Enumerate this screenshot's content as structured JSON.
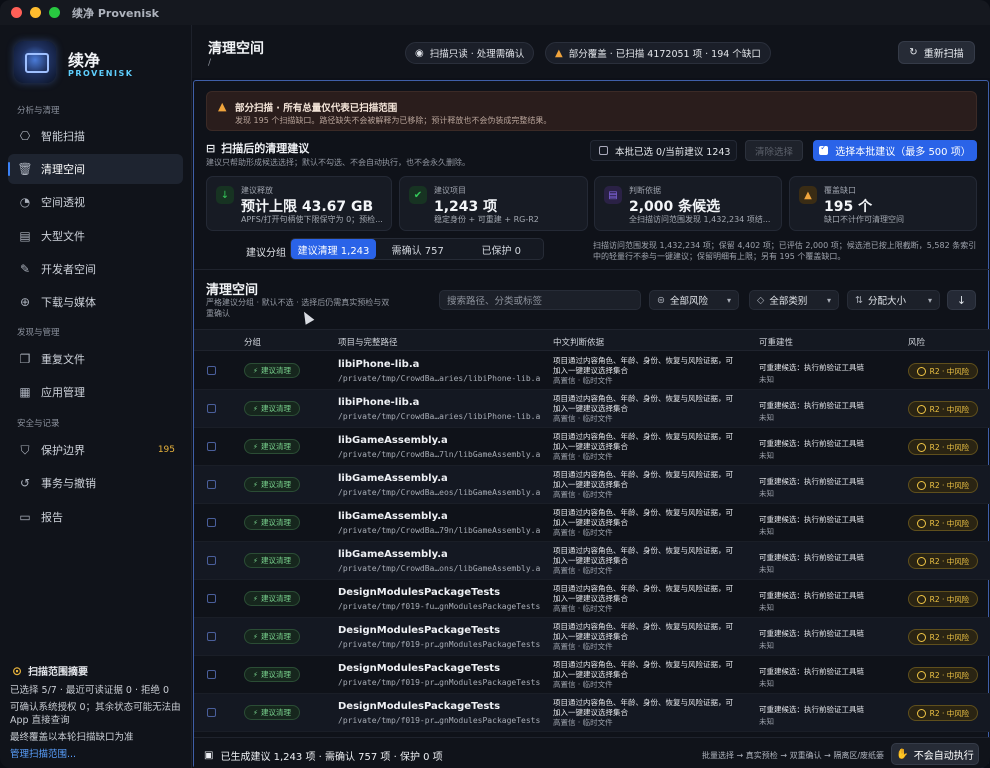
{
  "window": {
    "title": "续净 Provenisk"
  },
  "app": {
    "name": "续净",
    "subtitle": "PROVENISK"
  },
  "sidebar": {
    "sections": [
      {
        "title": "分析与清理",
        "items": [
          {
            "label": "智能扫描",
            "icon": "scan-icon"
          },
          {
            "label": "清理空间",
            "icon": "trash-icon",
            "active": true
          },
          {
            "label": "空间透视",
            "icon": "pie-icon"
          },
          {
            "label": "大型文件",
            "icon": "file-icon"
          },
          {
            "label": "开发者空间",
            "icon": "wrench-icon"
          },
          {
            "label": "下载与媒体",
            "icon": "download-icon"
          }
        ]
      },
      {
        "title": "发现与管理",
        "items": [
          {
            "label": "重复文件",
            "icon": "copy-icon"
          },
          {
            "label": "应用管理",
            "icon": "grid-icon"
          }
        ]
      },
      {
        "title": "安全与记录",
        "items": [
          {
            "label": "保护边界",
            "icon": "shield-icon",
            "count": "195"
          },
          {
            "label": "事务与撤销",
            "icon": "history-icon"
          },
          {
            "label": "报告",
            "icon": "report-icon"
          }
        ]
      }
    ],
    "summary": {
      "title": "扫描范围摘要",
      "lines": [
        "已选择 5/7 · 最近可读证据 0 · 拒绝 0",
        "可确认系统授权 0；其余状态可能无法由",
        "App 直接查询",
        "最终覆盖以本轮扫描缺口为准"
      ],
      "link": "管理扫描范围..."
    }
  },
  "header": {
    "title": "清理空间",
    "path": "/",
    "pill_scan": "扫描只读 · 处理需确认",
    "pill_coverage": "部分覆盖 · 已扫描 4172051 项 · 194 个缺口",
    "rescan": "重新扫描"
  },
  "warning": {
    "title": "部分扫描 · 所有总量仅代表已扫描范围",
    "detail": "发现 195 个扫描缺口。路径缺失不会被解释为已移除；预计释放也不会伪装成完整结果。"
  },
  "suggest": {
    "title": "扫描后的清理建议",
    "desc": "建议只帮助形成候选选择；默认不勾选、不会自动执行，也不会永久删除。",
    "batch_selected": "本批已选 0/当前建议 1243",
    "clear_btn": "清除选择",
    "select_btn": "选择本批建议（最多 500 项）"
  },
  "cards": [
    {
      "label": "建议释放",
      "value": "预计上限 43.67 GB",
      "sub": "APFS/打开句柄使下限保守为 0；预检...",
      "color": "#34c759",
      "icon": "download-icon"
    },
    {
      "label": "建议项目",
      "value": "1,243 项",
      "sub": "稳定身份 + 可重建 + RG-R2",
      "color": "#34c759",
      "icon": "shield-check-icon"
    },
    {
      "label": "判断依据",
      "value": "2,000 条候选",
      "sub": "全扫描访问范围发现 1,432,234 项结...",
      "color": "#8b6cf0",
      "icon": "doc-icon"
    },
    {
      "label": "覆盖缺口",
      "value": "195 个",
      "sub": "缺口不计作可清理空间",
      "color": "#f0a43c",
      "icon": "warning-icon"
    }
  ],
  "grouping": {
    "label": "建议分组",
    "segments": [
      "建议清理 1,243",
      "需确认 757",
      "已保护 0"
    ],
    "note": "扫描访问范围发现 1,432,234 项；保留 4,402 项；已评估 2,000 项；候选池已按上限截断，5,582 条索引中的轻量行不参与一键建议；保留明细有上限；另有 195 个覆盖缺口。"
  },
  "table_section": {
    "title": "清理空间",
    "desc": "严格建议分组 · 默认不选 · 选择后仍需真实预检与双重确认",
    "search_placeholder": "搜索路径、分类或标签",
    "filter_risk": "全部风险",
    "filter_category": "全部类别",
    "sort": "分配大小"
  },
  "table": {
    "headers": [
      "分组",
      "项目与完整路径",
      "中文判断依据",
      "可重建性",
      "风险"
    ],
    "rows": [
      {
        "group": "建议清理",
        "name": "libiPhone-lib.a",
        "path": "/private/tmp/CrowdBa…aries/libiPhone-lib.a",
        "basis1": "项目通过内容角色、年龄、身份、恢复与风险证据，可",
        "basis2": "加入一键建议选择集合",
        "basis3": "高置信 · 临时文件",
        "rebuild": "可重建候选：执行前验证工具链",
        "rebuild_sub": "未知",
        "risk": "R2 · 中风险"
      },
      {
        "group": "建议清理",
        "name": "libiPhone-lib.a",
        "path": "/private/tmp/CrowdBa…aries/libiPhone-lib.a",
        "basis1": "项目通过内容角色、年龄、身份、恢复与风险证据，可",
        "basis2": "加入一键建议选择集合",
        "basis3": "高置信 · 临时文件",
        "rebuild": "可重建候选：执行前验证工具链",
        "rebuild_sub": "未知",
        "risk": "R2 · 中风险"
      },
      {
        "group": "建议清理",
        "name": "libGameAssembly.a",
        "path": "/private/tmp/CrowdBa…7ln/libGameAssembly.a",
        "basis1": "项目通过内容角色、年龄、身份、恢复与风险证据，可",
        "basis2": "加入一键建议选择集合",
        "basis3": "高置信 · 临时文件",
        "rebuild": "可重建候选：执行前验证工具链",
        "rebuild_sub": "未知",
        "risk": "R2 · 中风险"
      },
      {
        "group": "建议清理",
        "name": "libGameAssembly.a",
        "path": "/private/tmp/CrowdBa…eos/libGameAssembly.a",
        "basis1": "项目通过内容角色、年龄、身份、恢复与风险证据，可",
        "basis2": "加入一键建议选择集合",
        "basis3": "高置信 · 临时文件",
        "rebuild": "可重建候选：执行前验证工具链",
        "rebuild_sub": "未知",
        "risk": "R2 · 中风险"
      },
      {
        "group": "建议清理",
        "name": "libGameAssembly.a",
        "path": "/private/tmp/CrowdBa…79n/libGameAssembly.a",
        "basis1": "项目通过内容角色、年龄、身份、恢复与风险证据，可",
        "basis2": "加入一键建议选择集合",
        "basis3": "高置信 · 临时文件",
        "rebuild": "可重建候选：执行前验证工具链",
        "rebuild_sub": "未知",
        "risk": "R2 · 中风险"
      },
      {
        "group": "建议清理",
        "name": "libGameAssembly.a",
        "path": "/private/tmp/CrowdBa…ons/libGameAssembly.a",
        "basis1": "项目通过内容角色、年龄、身份、恢复与风险证据，可",
        "basis2": "加入一键建议选择集合",
        "basis3": "高置信 · 临时文件",
        "rebuild": "可重建候选：执行前验证工具链",
        "rebuild_sub": "未知",
        "risk": "R2 · 中风险"
      },
      {
        "group": "建议清理",
        "name": "DesignModulesPackageTests",
        "path": "/private/tmp/f019-fu…gnModulesPackageTests",
        "basis1": "项目通过内容角色、年龄、身份、恢复与风险证据，可",
        "basis2": "加入一键建议选择集合",
        "basis3": "高置信 · 临时文件",
        "rebuild": "可重建候选：执行前验证工具链",
        "rebuild_sub": "未知",
        "risk": "R2 · 中风险"
      },
      {
        "group": "建议清理",
        "name": "DesignModulesPackageTests",
        "path": "/private/tmp/f019-pr…gnModulesPackageTests",
        "basis1": "项目通过内容角色、年龄、身份、恢复与风险证据，可",
        "basis2": "加入一键建议选择集合",
        "basis3": "高置信 · 临时文件",
        "rebuild": "可重建候选：执行前验证工具链",
        "rebuild_sub": "未知",
        "risk": "R2 · 中风险"
      },
      {
        "group": "建议清理",
        "name": "DesignModulesPackageTests",
        "path": "/private/tmp/f019-pr…gnModulesPackageTests",
        "basis1": "项目通过内容角色、年龄、身份、恢复与风险证据，可",
        "basis2": "加入一键建议选择集合",
        "basis3": "高置信 · 临时文件",
        "rebuild": "可重建候选：执行前验证工具链",
        "rebuild_sub": "未知",
        "risk": "R2 · 中风险"
      },
      {
        "group": "建议清理",
        "name": "DesignModulesPackageTests",
        "path": "/private/tmp/f019-pr…gnModulesPackageTests",
        "basis1": "项目通过内容角色、年龄、身份、恢复与风险证据，可",
        "basis2": "加入一键建议选择集合",
        "basis3": "高置信 · 临时文件",
        "rebuild": "可重建候选：执行前验证工具链",
        "rebuild_sub": "未知",
        "risk": "R2 · 中风险"
      }
    ]
  },
  "footer": {
    "summary": "已生成建议 1,243 项 · 需确认 757 项 · 保护 0 项",
    "flow": "批量选择 → 真实预检 → 双重确认 → 隔离区/废纸篓",
    "no_auto": "不会自动执行"
  },
  "colors": {
    "accent": "#2a63e8",
    "risk": "#f0c545",
    "suggest": "#79d38e",
    "warning": "#f0a43c"
  }
}
